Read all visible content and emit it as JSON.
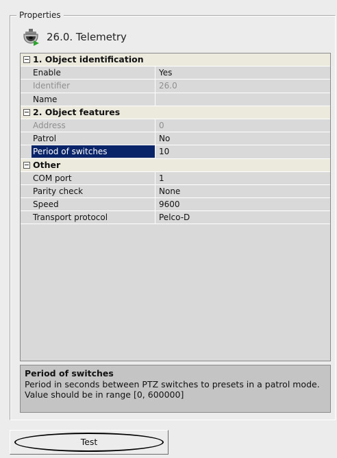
{
  "groupbox": {
    "title": "Properties"
  },
  "object": {
    "title": "26.0. Telemetry",
    "icon": "ptz-dome-camera-icon"
  },
  "grid": {
    "categories": [
      {
        "label": "1. Object identification",
        "expanded": true,
        "properties": [
          {
            "name": "Enable",
            "value": "Yes",
            "enabled": true,
            "selected": false
          },
          {
            "name": "Identifier",
            "value": "26.0",
            "enabled": false,
            "selected": false
          },
          {
            "name": "Name",
            "value": "",
            "enabled": true,
            "selected": false
          }
        ]
      },
      {
        "label": "2. Object features",
        "expanded": true,
        "properties": [
          {
            "name": "Address",
            "value": "0",
            "enabled": false,
            "selected": false
          },
          {
            "name": "Patrol",
            "value": "No",
            "enabled": true,
            "selected": false
          },
          {
            "name": "Period of switches",
            "value": "10",
            "enabled": true,
            "selected": true
          }
        ]
      },
      {
        "label": "Other",
        "expanded": true,
        "properties": [
          {
            "name": "COM port",
            "value": "1",
            "enabled": true,
            "selected": false
          },
          {
            "name": "Parity check",
            "value": "None",
            "enabled": true,
            "selected": false
          },
          {
            "name": "Speed",
            "value": "9600",
            "enabled": true,
            "selected": false
          },
          {
            "name": "Transport protocol",
            "value": "Pelco-D",
            "enabled": true,
            "selected": false
          }
        ]
      }
    ]
  },
  "description": {
    "title": "Period of switches",
    "text": "Period in seconds between PTZ  switches to presets in a patrol mode. Value should be in range [0, 600000]"
  },
  "actions": {
    "test_label": "Test"
  },
  "colors": {
    "selection": "#0a246a",
    "category_bg": "#ece9dd",
    "grid_bg": "#d9d9d9",
    "description_bg": "#c4c4c4",
    "disabled_text": "#8f8f8f"
  }
}
